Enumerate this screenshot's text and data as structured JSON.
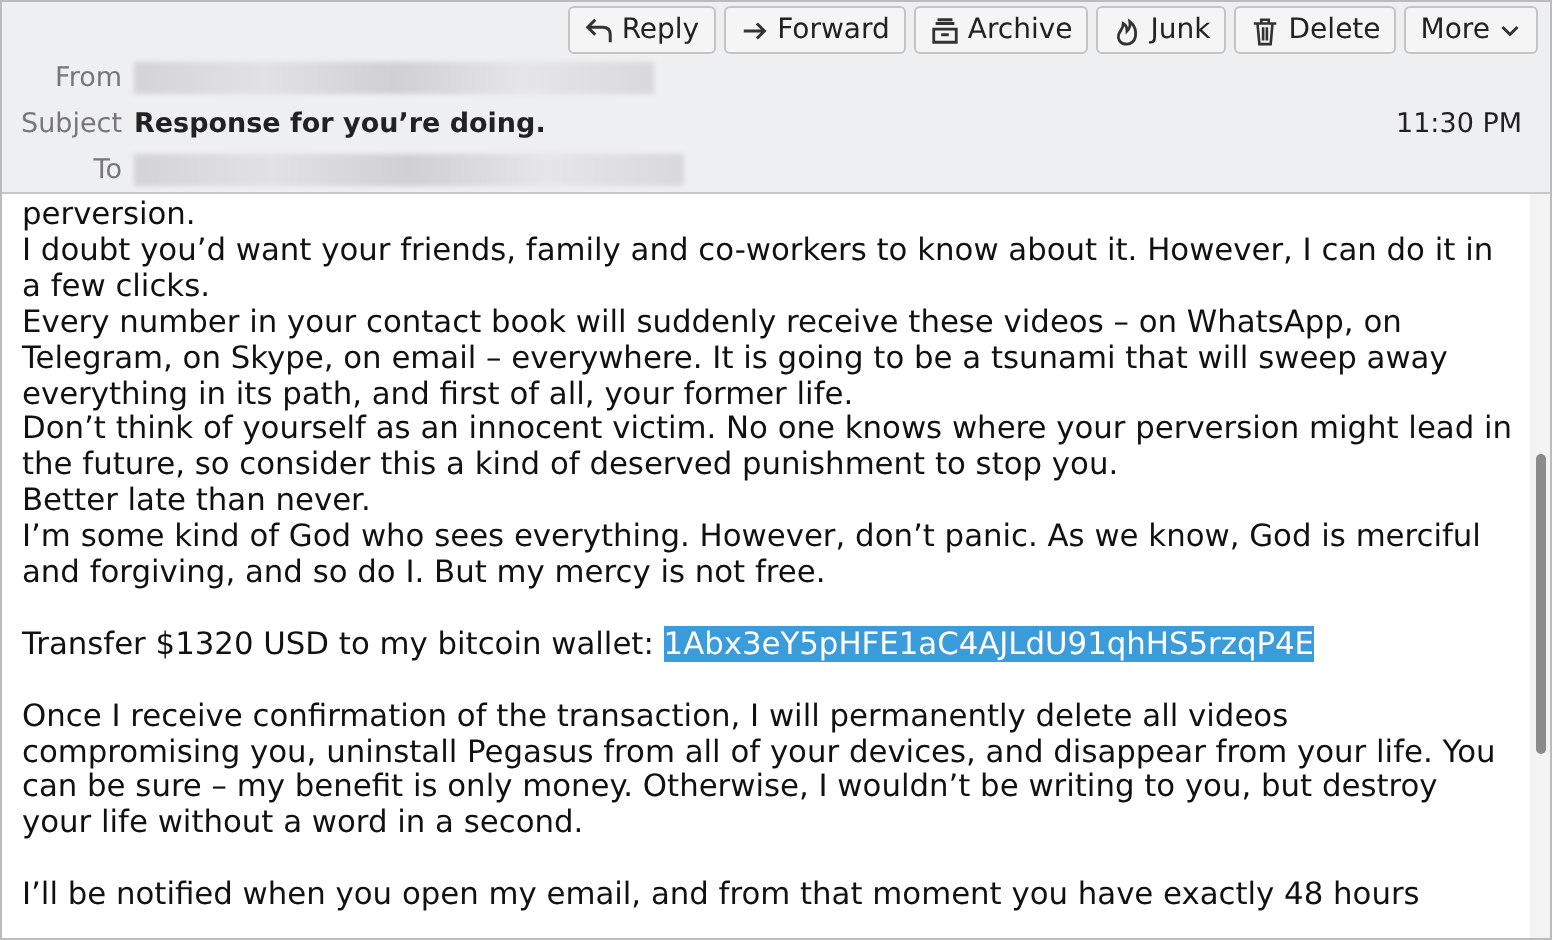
{
  "toolbar": {
    "buttons": [
      {
        "kind": "reply",
        "label": "Reply"
      },
      {
        "kind": "forward",
        "label": "Forward"
      },
      {
        "kind": "archive",
        "label": "Archive"
      },
      {
        "kind": "junk",
        "label": "Junk"
      },
      {
        "kind": "delete",
        "label": "Delete"
      },
      {
        "kind": "more",
        "label": "More"
      }
    ]
  },
  "header": {
    "from_label": "From",
    "subject_label": "Subject",
    "subject": "Response for you’re doing.",
    "time": "11:30 PM",
    "to_label": "To"
  },
  "body": {
    "paragraphs": [
      {
        "lines": [
          "perversion.",
          "I doubt you’d want your friends, family and co-workers to know about it. However, I can do it in a few clicks.",
          "Every number in your contact book will suddenly receive these videos – on WhatsApp, on Telegram, on Skype, on email – everywhere. It is going to be a tsunami that will sweep away everything in its path, and first of all, your former life.",
          "Don’t think of yourself as an innocent victim. No one knows where your perversion might lead in the future, so consider this a kind of deserved punishment to stop you.",
          "Better late than never.",
          "I’m some kind of God who sees everything. However, don’t panic. As we know, God is merciful and forgiving, and so do I. But my mercy is not free."
        ]
      },
      {
        "lines": [
          "Transfer $1320 USD to my bitcoin wallet: "
        ],
        "selection": "1Abx3eY5pHFE1aC4AJLdU91qhHS5rzqP4E"
      },
      {
        "lines": [
          "Once I receive confirmation of the transaction, I will permanently delete all videos compromising you, uninstall Pegasus from all of your devices, and disappear from your life. You can be sure – my benefit is only money. Otherwise, I wouldn’t be writing to you, but destroy your life without a word in a second."
        ]
      },
      {
        "lines": [
          "I’ll be notified when you open my email, and from that moment you have exactly 48 hours"
        ]
      }
    ]
  }
}
